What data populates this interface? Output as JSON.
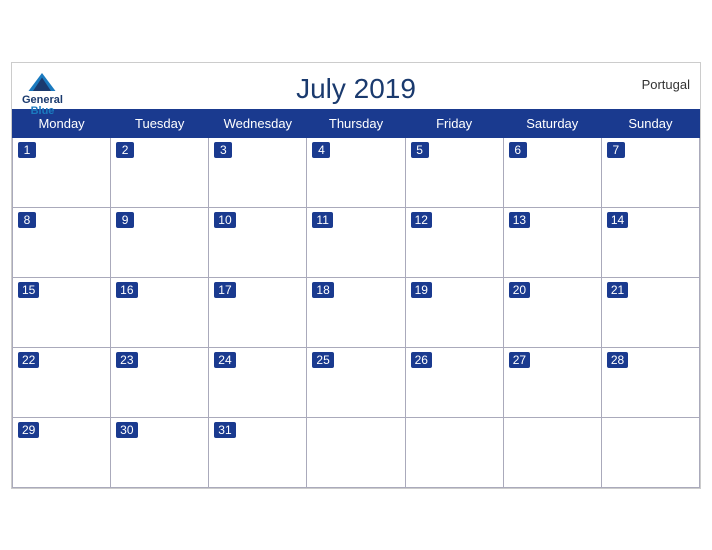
{
  "header": {
    "title": "July 2019",
    "country": "Portugal",
    "logo": {
      "line1": "General",
      "line2": "Blue"
    }
  },
  "weekdays": [
    "Monday",
    "Tuesday",
    "Wednesday",
    "Thursday",
    "Friday",
    "Saturday",
    "Sunday"
  ],
  "weeks": [
    [
      1,
      2,
      3,
      4,
      5,
      6,
      7
    ],
    [
      8,
      9,
      10,
      11,
      12,
      13,
      14
    ],
    [
      15,
      16,
      17,
      18,
      19,
      20,
      21
    ],
    [
      22,
      23,
      24,
      25,
      26,
      27,
      28
    ],
    [
      29,
      30,
      31,
      null,
      null,
      null,
      null
    ]
  ]
}
